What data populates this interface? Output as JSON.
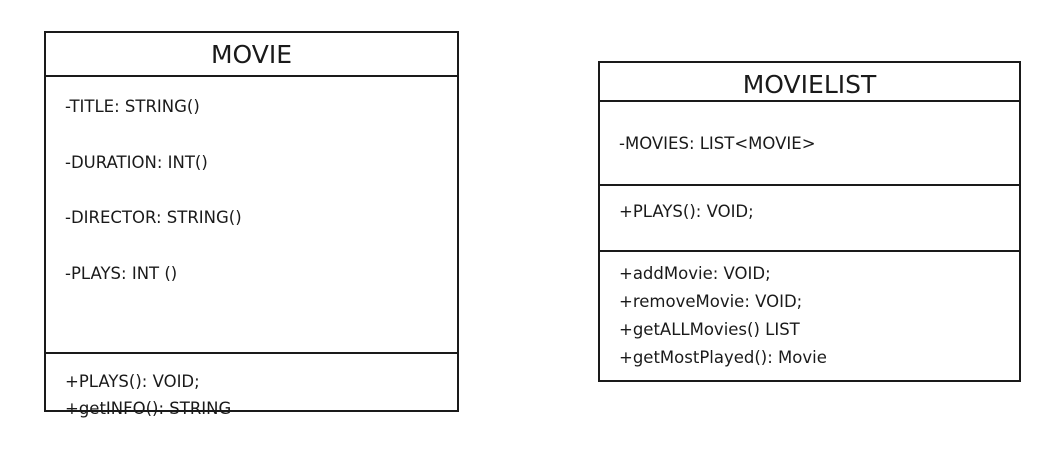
{
  "classes": {
    "movie": {
      "name": "MOVIE",
      "attributes": [
        "-TITLE: STRING()",
        "-DURATION: INT()",
        "-DIRECTOR: STRING()",
        "-PLAYS: INT ()"
      ],
      "methods": [
        "+PLAYS():  VOID;",
        "+getINFO():  STRING"
      ]
    },
    "movielist": {
      "name": "MOVIELIST",
      "attributes": [
        "-MOVIES:  LIST<MOVIE>"
      ],
      "plays_section": [
        "+PLAYS():  VOID;"
      ],
      "methods": [
        "+addMovie:  VOID;",
        "+removeMovie:  VOID;",
        "+getALLMovies()  LIST",
        "+getMostPlayed():  Movie"
      ]
    }
  }
}
